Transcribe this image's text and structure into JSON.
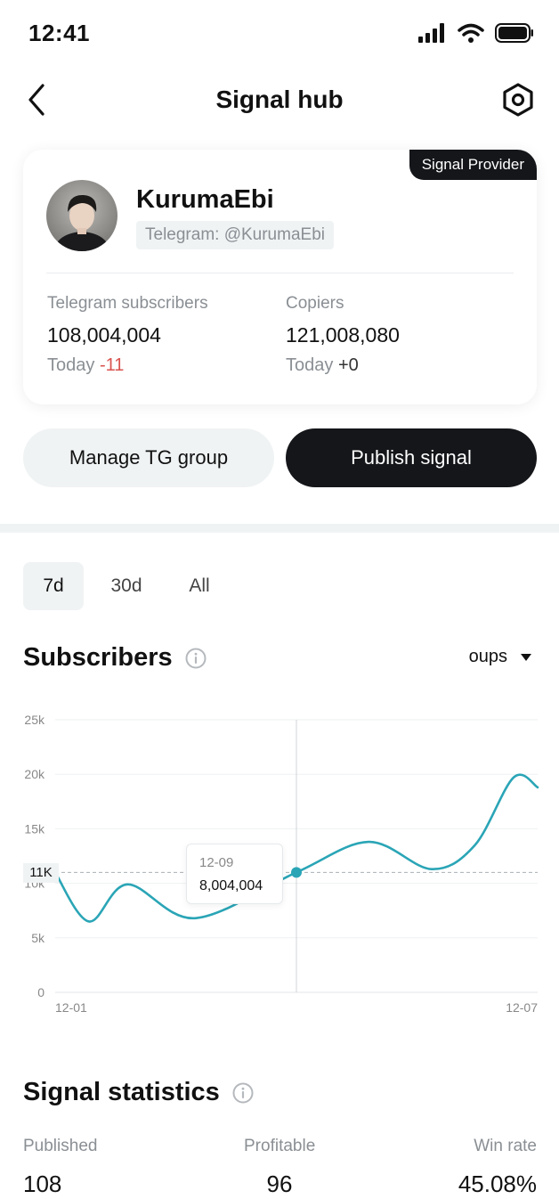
{
  "status_bar": {
    "time": "12:41"
  },
  "nav": {
    "title": "Signal hub"
  },
  "profile": {
    "badge": "Signal Provider",
    "name": "KurumaEbi",
    "handle": "Telegram: @KurumaEbi",
    "subscribers_label": "Telegram subscribers",
    "subscribers_value": "108,004,004",
    "subscribers_today_label": "Today",
    "subscribers_today_delta": "-11",
    "copiers_label": "Copiers",
    "copiers_value": "121,008,080",
    "copiers_today_label": "Today",
    "copiers_today_delta": "+0"
  },
  "actions": {
    "manage_label": "Manage TG group",
    "publish_label": "Publish signal"
  },
  "tabs": [
    {
      "label": "7d",
      "active": true
    },
    {
      "label": "30d",
      "active": false
    },
    {
      "label": "All",
      "active": false
    }
  ],
  "subscribers_section": {
    "title": "Subscribers",
    "dropdown_label": "oups"
  },
  "chart_data": {
    "type": "line",
    "x_labels": [
      "12-01",
      "12-07"
    ],
    "yticks": [
      "0",
      "5k",
      "10k",
      "15k",
      "20k",
      "25k"
    ],
    "ylim": [
      0,
      25000
    ],
    "series": [
      {
        "color": "#2aa5b6",
        "x": [
          0,
          0.07,
          0.15,
          0.29,
          0.5,
          0.65,
          0.78,
          0.87,
          0.95,
          1.0
        ],
        "values": [
          11000,
          6500,
          9900,
          6800,
          11000,
          13800,
          11300,
          13500,
          19700,
          18800
        ]
      }
    ],
    "reference_line": {
      "value": 11000,
      "label": "11K"
    },
    "tooltip": {
      "date": "12-09",
      "value": "8,004,004",
      "x": 0.5
    },
    "grid": true
  },
  "signal_stats": {
    "title": "Signal statistics",
    "published_label": "Published",
    "published_value": "108",
    "profitable_label": "Profitable",
    "profitable_value": "96",
    "winrate_label": "Win rate",
    "winrate_value": "45.08%"
  },
  "colors": {
    "accent": "#2aa5b6",
    "dark": "#15161a",
    "muted": "#8a8f94",
    "negative": "#d9534f"
  }
}
